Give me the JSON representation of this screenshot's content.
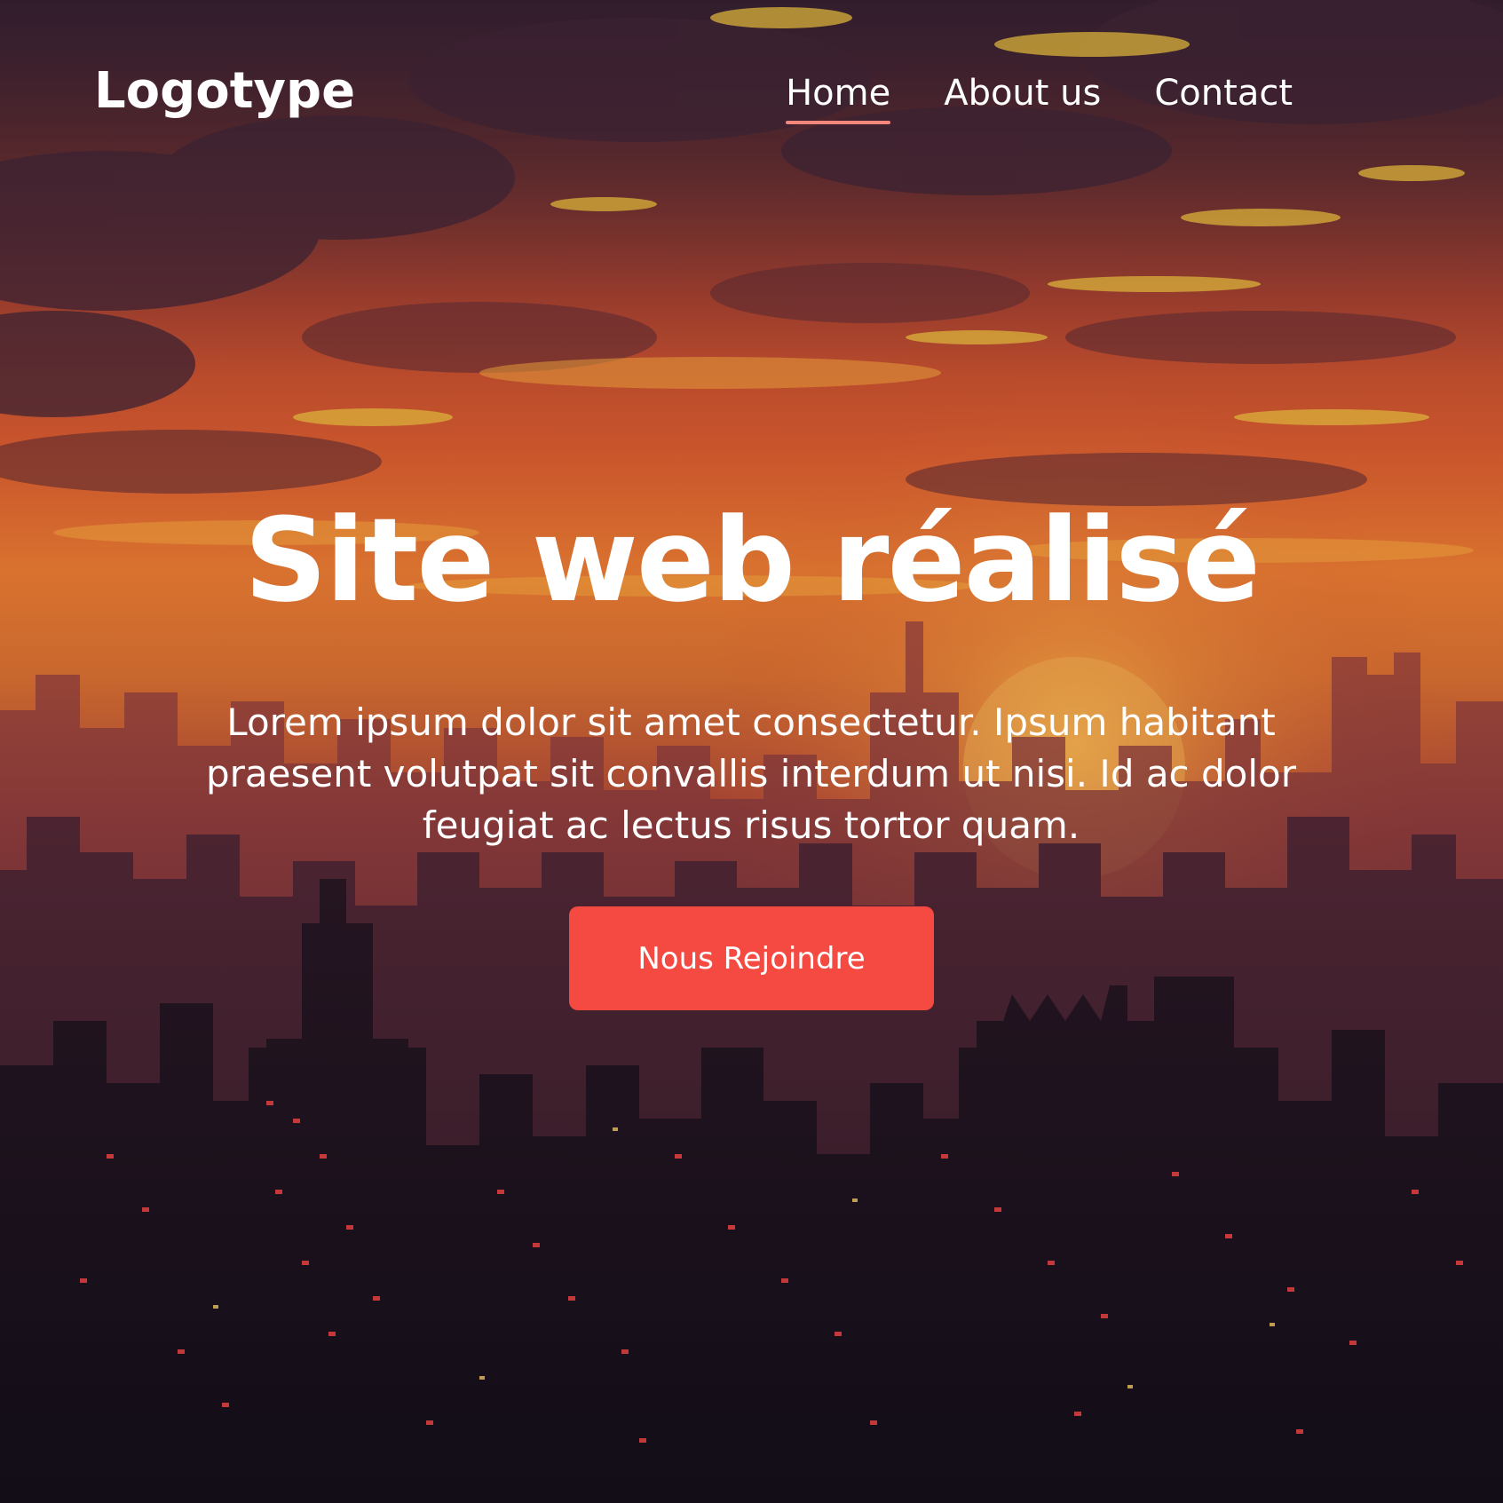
{
  "header": {
    "logo": "Logotype",
    "nav": [
      {
        "label": "Home",
        "active": true
      },
      {
        "label": "About us",
        "active": false
      },
      {
        "label": "Contact",
        "active": false
      }
    ]
  },
  "hero": {
    "title": "Site web réalisé",
    "text": "Lorem ipsum dolor sit amet consectetur. Ipsum habitant praesent volutpat sit convallis interdum ut nisi. Id ac dolor feugiat ac lectus risus tortor quam.",
    "cta_label": "Nous Rejoindre"
  },
  "colors": {
    "accent": "#f44a42",
    "nav_underline": "#f4877c",
    "text": "#ffffff"
  }
}
